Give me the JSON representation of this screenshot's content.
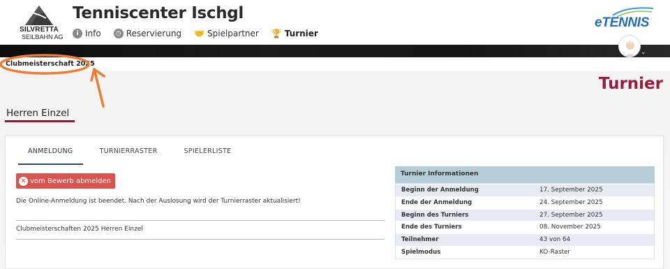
{
  "brand": {
    "logo_line1": "SILVRETTA",
    "logo_line2": "SEILBAHN AG",
    "etennis": "eTENNIS"
  },
  "site_title": "Tenniscenter Ischgl",
  "nav": [
    {
      "label": "Info",
      "icon": "info-icon"
    },
    {
      "label": "Reservierung",
      "icon": "clock-icon"
    },
    {
      "label": "Spielpartner",
      "icon": "handshake-icon"
    },
    {
      "label": "Turnier",
      "icon": "trophy-icon"
    }
  ],
  "breadcrumb": "Clubmeisterschaft 2025",
  "page_heading": "Turnier",
  "section_title": "Herren Einzel",
  "tabs": [
    "ANMELDUNG",
    "TURNIERRASTER",
    "SPIELERLISTE"
  ],
  "unsubscribe_label": "vom Bewerb abmelden",
  "notice": "Die Online-Anmeldung ist beendet. Nach der Auslosung wird der Turnierraster aktualisiert!",
  "competition_name": "Clubmeisterschaften 2025 Herren Einzel",
  "info": {
    "title": "Turnier Informationen",
    "rows": [
      {
        "label": "Beginn der Anmeldung",
        "value": "17. September 2025"
      },
      {
        "label": "Ende der Anmeldung",
        "value": "24. September 2025"
      },
      {
        "label": "Beginn des Turniers",
        "value": "27. September 2025"
      },
      {
        "label": "Ende des Turniers",
        "value": "08. November 2025"
      },
      {
        "label": "Teilnehmer",
        "value": "43 von 64"
      },
      {
        "label": "Spielmodus",
        "value": "KO-Raster"
      }
    ]
  },
  "colors": {
    "accent": "#9b1b3d",
    "danger": "#d9534f",
    "info_header": "#b5cdd6",
    "annotation": "#f07a2f"
  }
}
